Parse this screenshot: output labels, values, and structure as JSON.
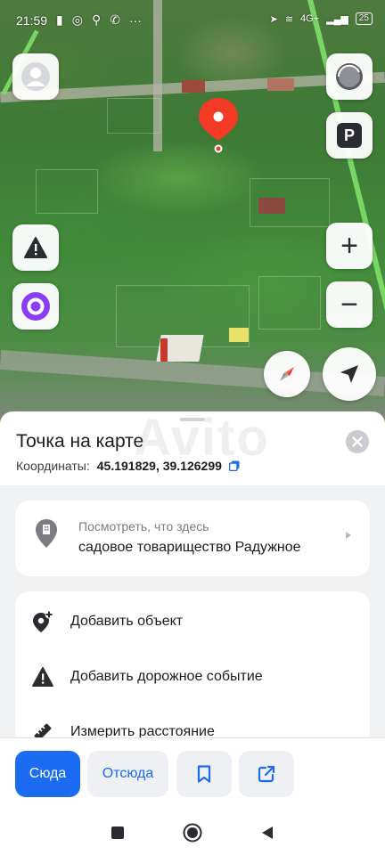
{
  "status_bar": {
    "time": "21:59",
    "network": "4G+",
    "battery": "25"
  },
  "map": {
    "controls": {
      "profile_icon": "avatar-icon",
      "speed_icon": "gauge-icon",
      "parking_label": "P",
      "zoom_in": "+",
      "zoom_out": "−"
    }
  },
  "sheet": {
    "title": "Точка на карте",
    "coords_label": "Координаты:",
    "coords_value": "45.191829, 39.126299",
    "place_hint": "Посмотреть, что здесь",
    "place_name": "садовое товарищество Радужное",
    "actions": [
      {
        "label": "Добавить объект",
        "icon": "add-place-icon"
      },
      {
        "label": "Добавить дорожное событие",
        "icon": "warning-icon"
      },
      {
        "label": "Измерить расстояние",
        "icon": "ruler-icon"
      }
    ]
  },
  "bottom_bar": {
    "to_here": "Сюда",
    "from_here": "Отсюда",
    "bookmark_icon": "bookmark-icon",
    "share_icon": "share-icon"
  },
  "colors": {
    "accent": "#1b6cf2",
    "pin": "#f23a25",
    "alice": "#8a3ff5"
  },
  "watermark": "Avito"
}
